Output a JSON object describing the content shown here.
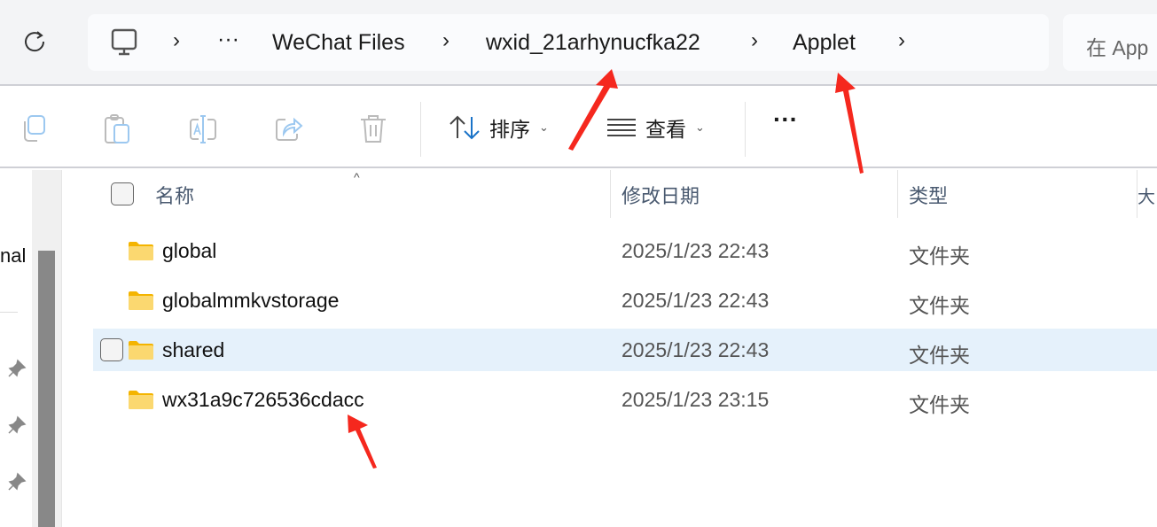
{
  "address_bar": {
    "overflow": "···",
    "segments": [
      "WeChat Files",
      "wxid_21arhynucfka22",
      "Applet"
    ]
  },
  "search": {
    "placeholder": "在 App"
  },
  "toolbar": {
    "sort_label": "排序",
    "view_label": "查看",
    "more_label": "···"
  },
  "sidebar": {
    "partial_label": "nal"
  },
  "columns": {
    "name": "名称",
    "modified": "修改日期",
    "type": "类型",
    "size": "大"
  },
  "files": [
    {
      "name": "global",
      "modified": "2025/1/23 22:43",
      "type": "文件夹"
    },
    {
      "name": "globalmmkvstorage",
      "modified": "2025/1/23 22:43",
      "type": "文件夹"
    },
    {
      "name": "shared",
      "modified": "2025/1/23 22:43",
      "type": "文件夹",
      "hovered": true
    },
    {
      "name": "wx31a9c726536cdacc",
      "modified": "2025/1/23 23:15",
      "type": "文件夹"
    }
  ],
  "colors": {
    "hover_row": "#e5f1fb",
    "annotation_arrow": "#f5281e",
    "folder": "#f8cf5a"
  }
}
